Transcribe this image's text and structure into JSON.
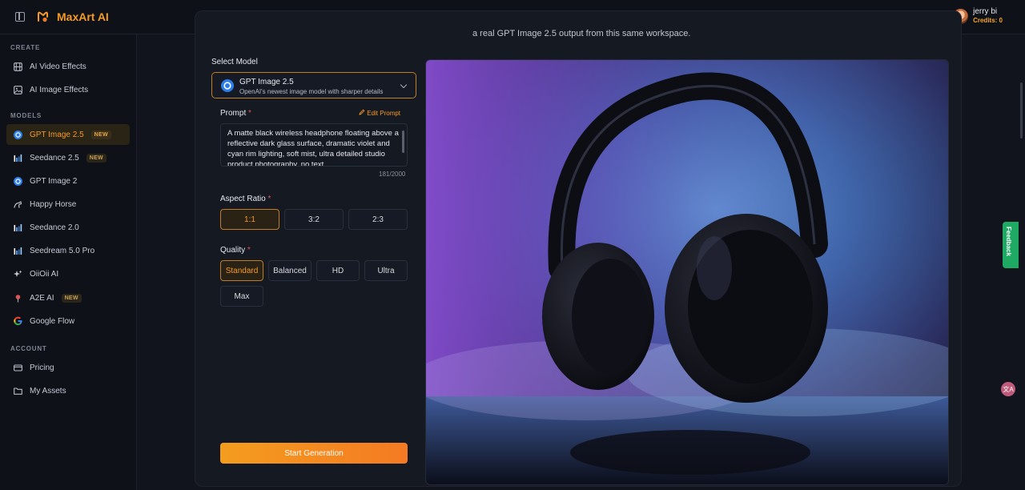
{
  "app": {
    "brand": "MaxArt AI"
  },
  "user": {
    "name": "jerry bi",
    "credits": "Credits: 0"
  },
  "sidebar": {
    "sections": [
      {
        "title": "CREATE"
      },
      {
        "title": "MODELS"
      },
      {
        "title": "ACCOUNT"
      }
    ],
    "items": [
      {
        "label": "AI Video Effects",
        "icon": "film-icon"
      },
      {
        "label": "AI Image Effects",
        "icon": "image-icon"
      },
      {
        "label": "GPT Image 2.5",
        "icon": "gpt-logo-icon",
        "badge": "NEW",
        "active": true
      },
      {
        "label": "Seedance 2.5",
        "icon": "bars-logo-icon",
        "badge": "NEW"
      },
      {
        "label": "GPT Image 2",
        "icon": "gpt-logo-icon"
      },
      {
        "label": "Happy Horse",
        "icon": "horse-icon"
      },
      {
        "label": "Seedance 2.0",
        "icon": "bars-logo-icon"
      },
      {
        "label": "Seedream 5.0 Pro",
        "icon": "bars-logo-icon"
      },
      {
        "label": "OiiOii AI",
        "icon": "sparkle-icon"
      },
      {
        "label": "A2E AI",
        "icon": "pin-icon",
        "badge": "NEW"
      },
      {
        "label": "Google Flow",
        "icon": "google-icon"
      },
      {
        "label": "Pricing",
        "icon": "card-icon"
      },
      {
        "label": "My Assets",
        "icon": "folder-icon"
      }
    ]
  },
  "main": {
    "caption": "a real GPT Image 2.5 output from this same workspace.",
    "select_model_label": "Select Model",
    "model": {
      "name": "GPT Image 2.5",
      "description": "OpenAI's newest image model with sharper details"
    },
    "prompt_label": "Prompt",
    "required_mark": "*",
    "edit_prompt": "Edit Prompt",
    "prompt_text": "A matte black wireless headphone floating above a reflective dark glass surface, dramatic violet and cyan rim lighting, soft mist, ultra detailed studio product photography, no text",
    "prompt_counter": "181/2000",
    "aspect_ratio_label": "Aspect Ratio",
    "aspect_ratios": [
      "1:1",
      "3:2",
      "2:3"
    ],
    "selected_aspect": "1:1",
    "quality_label": "Quality",
    "qualities": [
      "Standard",
      "Balanced",
      "HD",
      "Ultra",
      "Max"
    ],
    "selected_quality": "Standard",
    "start_button": "Start Generation"
  },
  "feedback": "Feedback",
  "colors": {
    "accent": "#f59a23",
    "background": "#11141d",
    "panel": "#151922",
    "feedback": "#1faa63"
  }
}
